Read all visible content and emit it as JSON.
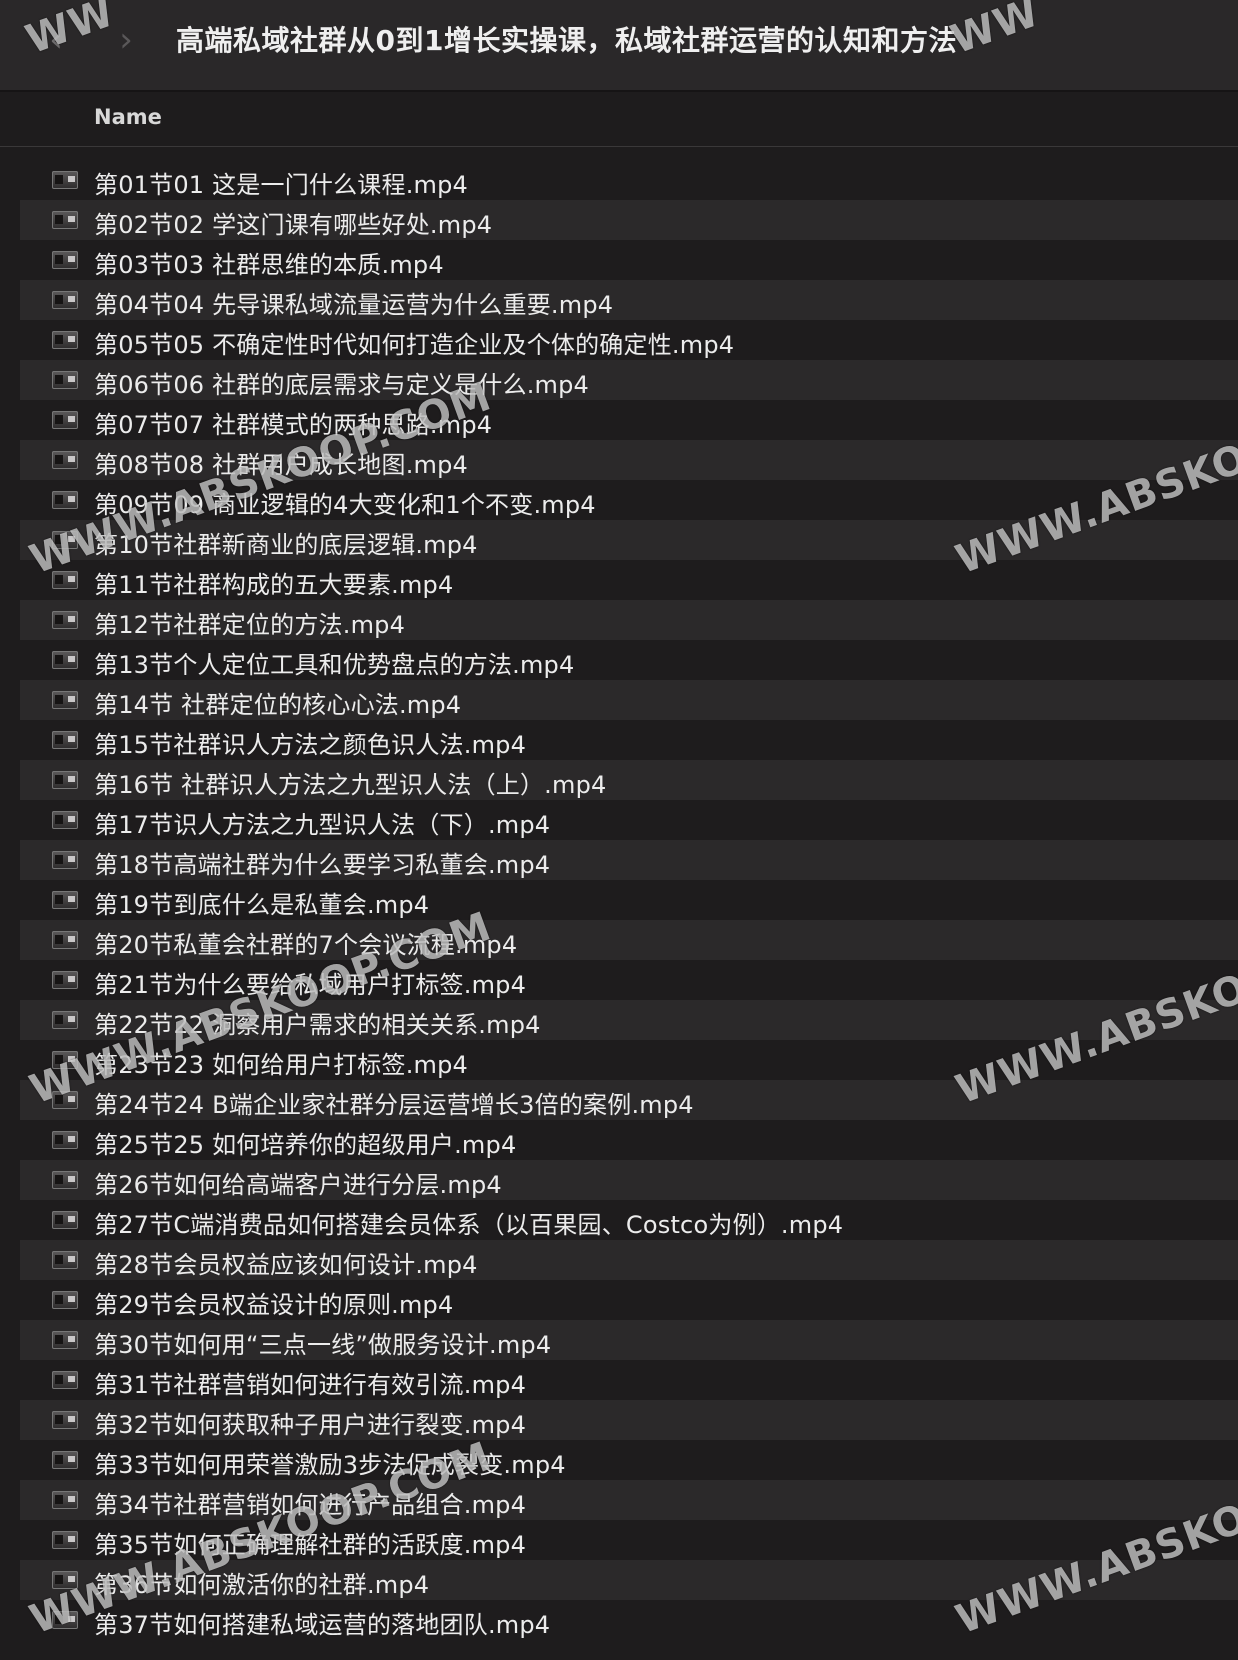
{
  "window": {
    "title": "高端私域社群从0到1增长实操课，私域社群运营的认知和方法",
    "back_icon": "‹",
    "forward_icon": "›"
  },
  "column_header": {
    "name": "Name"
  },
  "files": [
    "第01节01 这是一门什么课程.mp4",
    "第02节02 学这门课有哪些好处.mp4",
    "第03节03 社群思维的本质.mp4",
    "第04节04 先导课私域流量运营为什么重要.mp4",
    "第05节05 不确定性时代如何打造企业及个体的确定性.mp4",
    "第06节06 社群的底层需求与定义是什么.mp4",
    "第07节07 社群模式的两种思路.mp4",
    "第08节08 社群用户成长地图.mp4",
    "第09节09 商业逻辑的4大变化和1个不变.mp4",
    "第10节社群新商业的底层逻辑.mp4",
    "第11节社群构成的五大要素.mp4",
    "第12节社群定位的方法.mp4",
    "第13节个人定位工具和优势盘点的方法.mp4",
    "第14节 社群定位的核心心法.mp4",
    "第15节社群识人方法之颜色识人法.mp4",
    "第16节 社群识人方法之九型识人法（上）.mp4",
    "第17节识人方法之九型识人法（下）.mp4",
    "第18节高端社群为什么要学习私董会.mp4",
    "第19节到底什么是私董会.mp4",
    "第20节私董会社群的7个会议流程.mp4",
    "第21节为什么要给私域用户打标签.mp4",
    "第22节22 洞察用户需求的相关关系.mp4",
    "第23节23 如何给用户打标签.mp4",
    "第24节24 B端企业家社群分层运营增长3倍的案例.mp4",
    "第25节25 如何培养你的超级用户.mp4",
    "第26节如何给高端客户进行分层.mp4",
    "第27节C端消费品如何搭建会员体系（以百果园、Costco为例）.mp4",
    "第28节会员权益应该如何设计.mp4",
    "第29节会员权益设计的原则.mp4",
    "第30节如何用“三点一线”做服务设计.mp4",
    "第31节社群营销如何进行有效引流.mp4",
    "第32节如何获取种子用户进行裂变.mp4",
    "第33节如何用荣誉激励3步法促成裂变.mp4",
    "第34节社群营销如何进行产品组合.mp4",
    "第35节如何正确理解社群的活跃度.mp4",
    "第36节如何激活你的社群.mp4",
    "第37节如何搭建私域运营的落地团队.mp4"
  ],
  "watermark": "WWW.ABSKOOP.COM",
  "watermark_cropped_right": "WWW.ABSKOO",
  "watermark_cropped_top": "WW"
}
